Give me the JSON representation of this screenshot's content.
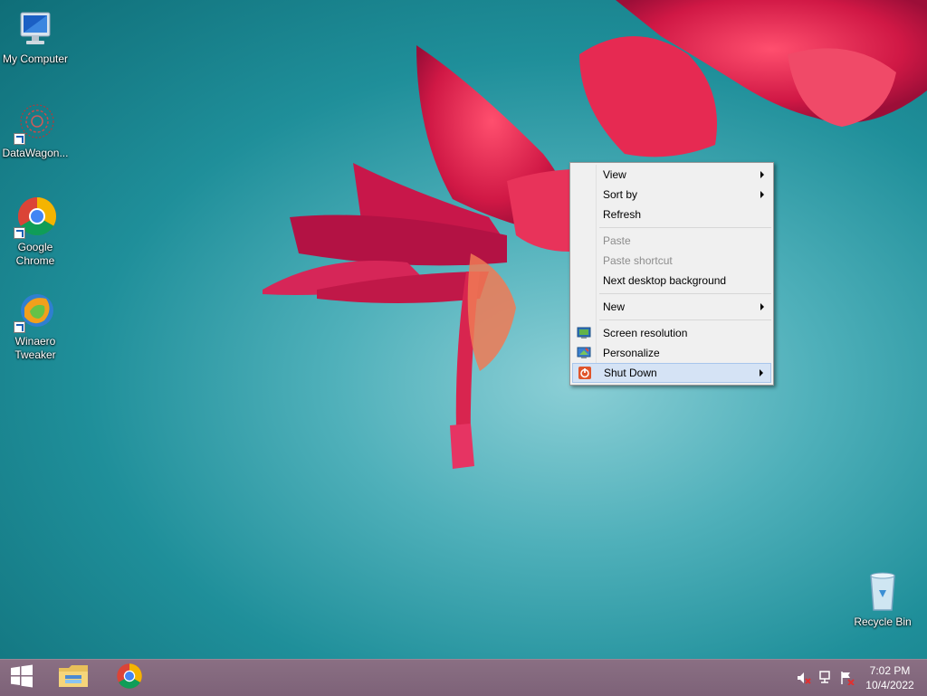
{
  "desktop": {
    "icons": [
      {
        "label": "My Computer"
      },
      {
        "label": "DataWagon..."
      },
      {
        "label": "Google Chrome"
      },
      {
        "label": "Winaero Tweaker"
      }
    ],
    "recycle_bin": {
      "label": "Recycle Bin"
    }
  },
  "context_menu": {
    "items": [
      {
        "label": "View",
        "submenu": true,
        "enabled": true
      },
      {
        "label": "Sort by",
        "submenu": true,
        "enabled": true
      },
      {
        "label": "Refresh",
        "submenu": false,
        "enabled": true
      },
      {
        "label": "Paste",
        "submenu": false,
        "enabled": false
      },
      {
        "label": "Paste shortcut",
        "submenu": false,
        "enabled": false
      },
      {
        "label": "Next desktop background",
        "submenu": false,
        "enabled": true
      },
      {
        "label": "New",
        "submenu": true,
        "enabled": true
      },
      {
        "label": "Screen resolution",
        "submenu": false,
        "enabled": true,
        "icon": "monitor-icon"
      },
      {
        "label": "Personalize",
        "submenu": false,
        "enabled": true,
        "icon": "personalize-icon"
      },
      {
        "label": "Shut Down",
        "submenu": true,
        "enabled": true,
        "icon": "power-icon",
        "highlighted": true
      }
    ]
  },
  "taskbar": {
    "pinned": [
      {
        "icon": "start-windows-icon"
      },
      {
        "icon": "file-explorer-icon"
      },
      {
        "icon": "chrome-icon"
      }
    ],
    "tray": {
      "icons": [
        "volume-muted-icon",
        "network-icon",
        "action-center-icon"
      ],
      "time": "7:02 PM",
      "date": "10/4/2022"
    }
  },
  "colors": {
    "taskbar": "#7d6278",
    "menu_highlight": "#d5e3f5",
    "wallpaper_teal": "#1f8f9a"
  }
}
